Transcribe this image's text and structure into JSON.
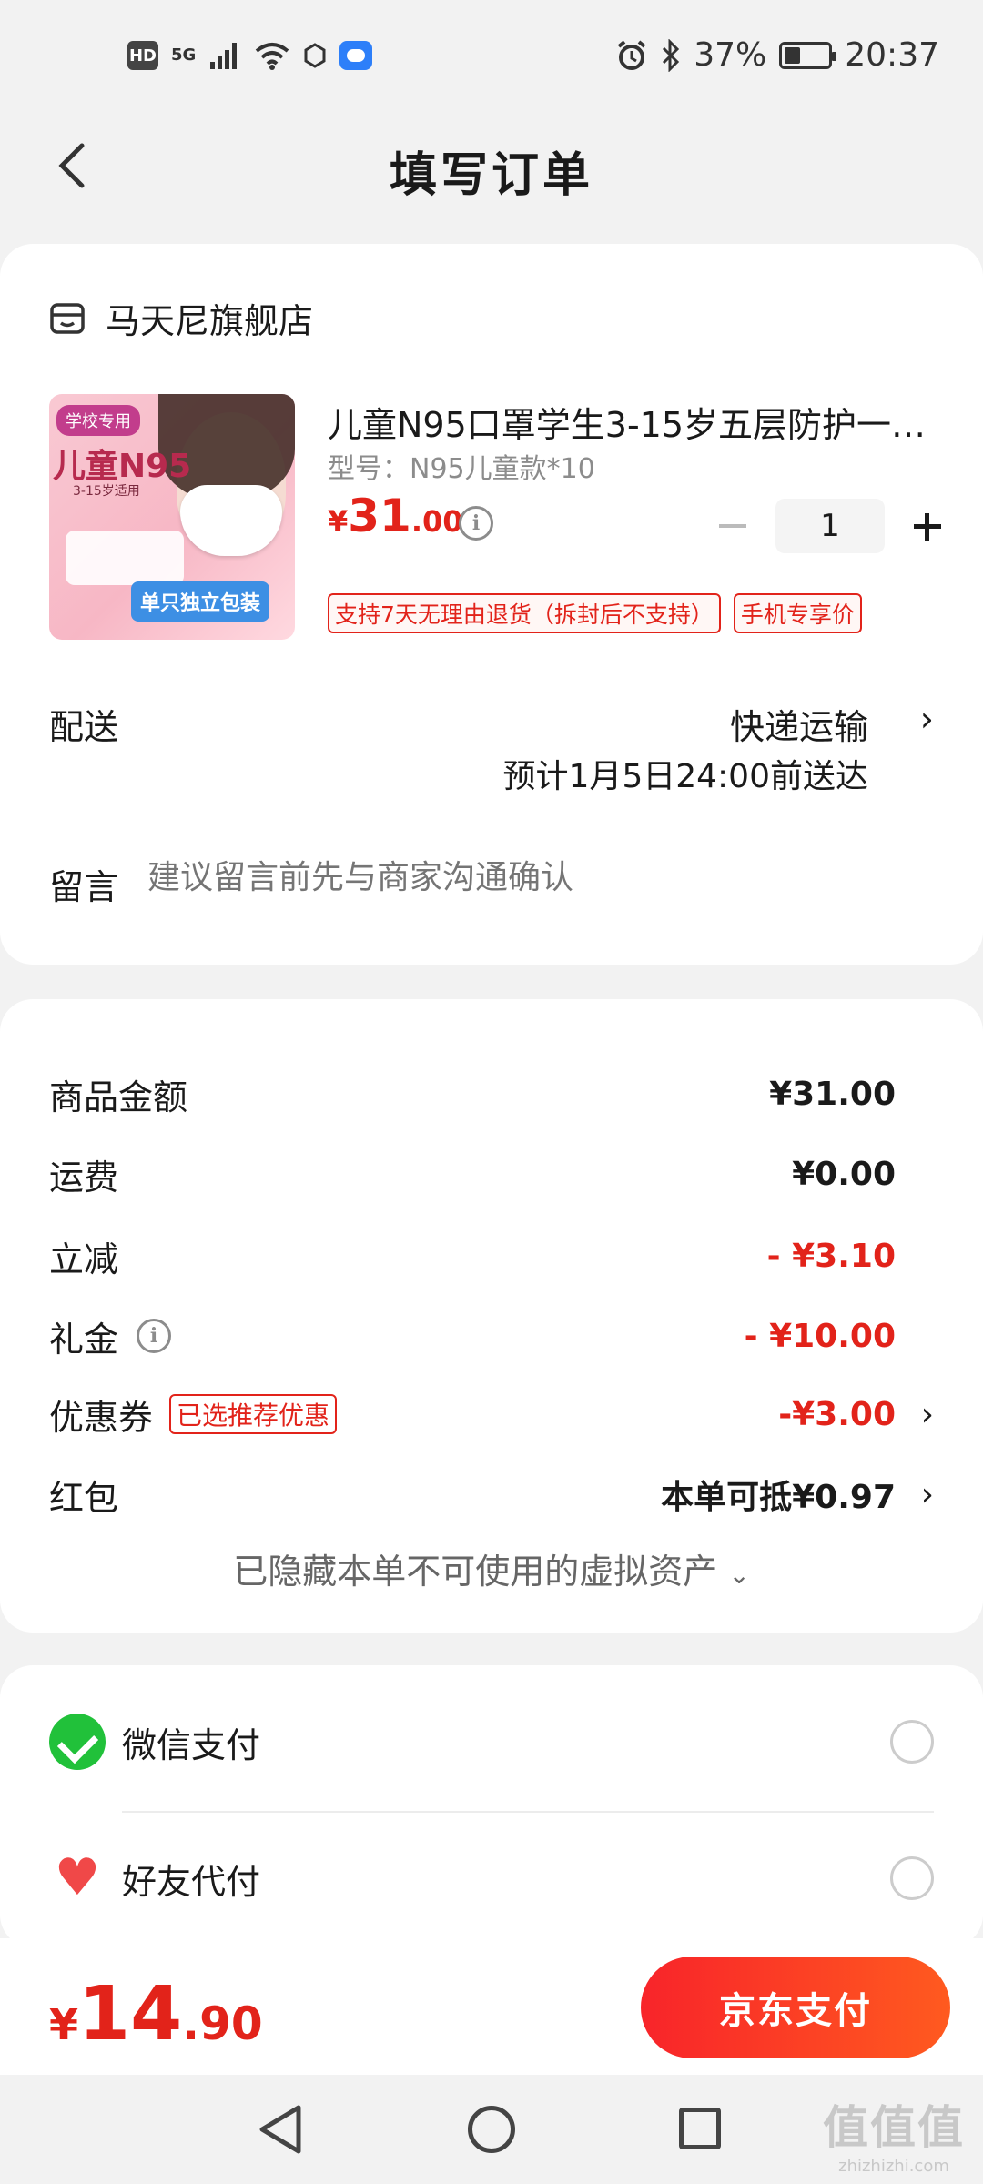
{
  "status_bar": {
    "hd": "HD",
    "network": "5G",
    "battery_text": "37%",
    "battery_level": 0.37,
    "time": "20:37"
  },
  "header": {
    "title": "填写订单"
  },
  "shop": {
    "name": "马天尼旗舰店"
  },
  "product": {
    "image_tag": "学校专用",
    "image_headline": "儿童N95",
    "image_age": "3-15岁适用",
    "image_banner": "单只独立包装",
    "title": "儿童N95口罩学生3-15岁五层防护一…",
    "spec": "型号：N95儿童款*10",
    "price_currency": "¥",
    "price_int": "31",
    "price_dec": ".00",
    "quantity": "1",
    "tags": [
      "支持7天无理由退货（拆封后不支持）",
      "手机专享价"
    ]
  },
  "delivery": {
    "label": "配送",
    "method": "快递运输",
    "eta": "预计1月5日24:00前送达"
  },
  "message": {
    "label": "留言",
    "placeholder": "建议留言前先与商家沟通确认"
  },
  "summary": {
    "goods_label": "商品金额",
    "goods_value": "¥31.00",
    "shipping_label": "运费",
    "shipping_value": "¥0.00",
    "discount_label": "立减",
    "discount_value": "- ¥3.10",
    "gift_label": "礼金",
    "gift_value": "- ¥10.00",
    "coupon_label": "优惠券",
    "coupon_tag": "已选推荐优惠",
    "coupon_value": "-¥3.00",
    "redpacket_label": "红包",
    "redpacket_value": "本单可抵¥0.97",
    "hidden_assets": "已隐藏本单不可使用的虚拟资产"
  },
  "payment": {
    "wechat_label": "微信支付",
    "friend_label": "好友代付"
  },
  "bottom": {
    "total_currency": "¥",
    "total_int": "14",
    "total_dec": ".90",
    "pay_button": "京东支付"
  },
  "watermark": {
    "line1": "值值值",
    "line2": "zhizhizhi.com"
  },
  "colors": {
    "accent": "#e2231a",
    "wechat": "#21c13a",
    "cloud": "#2d7ff9"
  }
}
